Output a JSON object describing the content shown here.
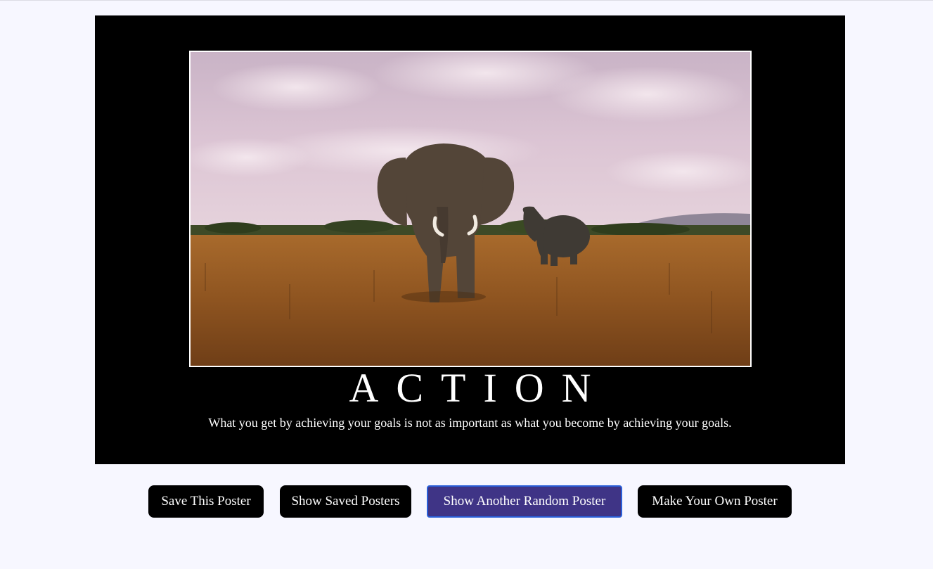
{
  "poster": {
    "title": "ACTION",
    "quote": "What you get by achieving your goals is not as important as what you become by achieving your goals.",
    "image": "savanna-elephants-photo"
  },
  "buttons": {
    "save": "Save This Poster",
    "show_saved": "Show Saved Posters",
    "random": "Show Another Random Poster",
    "make_own": "Make Your Own Poster"
  },
  "colors": {
    "background": "#f7f7ff",
    "poster_bg": "#000000",
    "button_bg": "#000000",
    "active_button_bg": "#3f3486",
    "active_button_border": "#2a5fd8"
  }
}
